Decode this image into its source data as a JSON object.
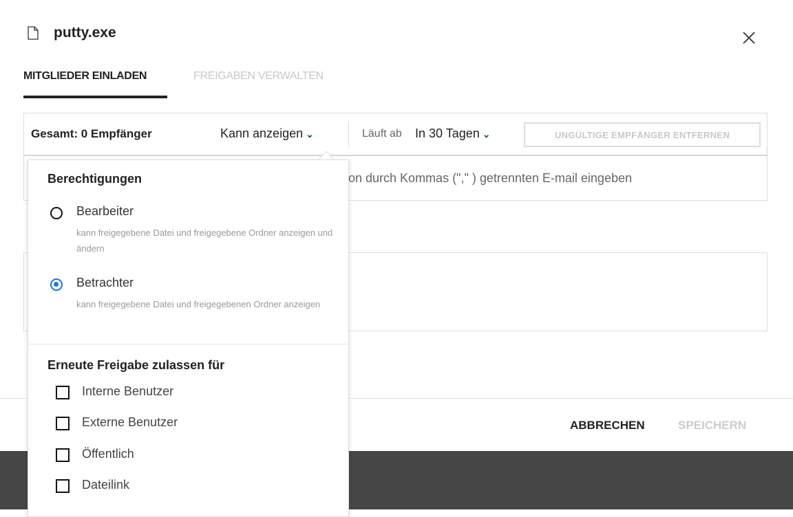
{
  "header": {
    "title": "putty.exe"
  },
  "tabs": [
    {
      "label": "MITGLIEDER EINLADEN",
      "active": true
    },
    {
      "label": "FREIGABEN VERWALTEN",
      "active": false
    }
  ],
  "toolbar": {
    "total": "Gesamt: 0 Empfänger",
    "permission": "Kann anzeigen",
    "expires_label": "Läuft ab",
    "expires_value": "In 30 Tagen",
    "remove_invalid": "UNGÜLTIGE EMPFÄNGER ENTFERNEN"
  },
  "input": {
    "placeholder": "Benutzer oder Gruppen suchen oder durch Kommas (\",\" ) getrennten E-mail eingeben",
    "visible_placeholder": "on durch Kommas (\",\" ) getrennten E-mail eingeben"
  },
  "footer": {
    "cancel": "ABBRECHEN",
    "save": "SPEICHERN"
  },
  "popup": {
    "permissions_title": "Berechtigungen",
    "options": [
      {
        "label": "Bearbeiter",
        "desc": "kann freigegebene Datei und freigegebene Ordner anzeigen und ändern",
        "selected": false
      },
      {
        "label": "Betrachter",
        "desc": "kann freigegebene Datei und freigegebenen Ordner anzeigen",
        "selected": true
      }
    ],
    "reshare_title": "Erneute Freigabe zulassen für",
    "reshare": [
      {
        "label": "Interne Benutzer",
        "checked": false
      },
      {
        "label": "Externe Benutzer",
        "checked": false
      },
      {
        "label": "Öffentlich",
        "checked": false
      },
      {
        "label": "Dateilink",
        "checked": false
      }
    ]
  },
  "colors": {
    "accent": "#1a73e8",
    "chevron": "#0b4c6f"
  }
}
